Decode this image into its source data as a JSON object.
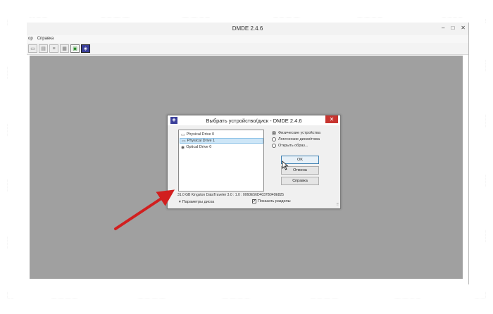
{
  "app": {
    "title": "DMDE 2.4.6",
    "menu": [
      "ор",
      "Справка"
    ],
    "controls": {
      "minimize": "–",
      "maximize": "□",
      "close": "✕"
    }
  },
  "toolbar": {
    "buttons": [
      "disk-icon",
      "partition-icon",
      "list-icon",
      "image-icon",
      "green-disk-icon",
      "dmde-logo-icon"
    ]
  },
  "dialog": {
    "title": "Выбрать устройство/диск - DMDE 2.4.6",
    "close": "✕",
    "devices": [
      {
        "label": "Physical Drive 0",
        "selected": false
      },
      {
        "label": "Physical Drive 1",
        "selected": true
      },
      {
        "label": "Optical Drive 0",
        "selected": false
      }
    ],
    "radios": [
      {
        "label": "Физические устройства",
        "checked": true
      },
      {
        "label": "Логические диски/тома",
        "checked": false
      },
      {
        "label": "Открыть образ...",
        "checked": false
      }
    ],
    "buttons": {
      "ok": "OK",
      "cancel": "Отмена",
      "help": "Справка"
    },
    "device_info": "31.0 GB Kingston DataTraveler 3.0 : 1.0 : 0060E56D4037B040E825",
    "params_label": "Параметры диска",
    "params_arrow": "▾",
    "show_partitions_label": "Показать разделы",
    "show_partitions_checked": "✔",
    "grip": "⠿"
  },
  "colors": {
    "workspace": "#a0a0a0",
    "close_red": "#c7342f",
    "selection": "#cde6f7",
    "arrow_red": "#d11f1f"
  }
}
